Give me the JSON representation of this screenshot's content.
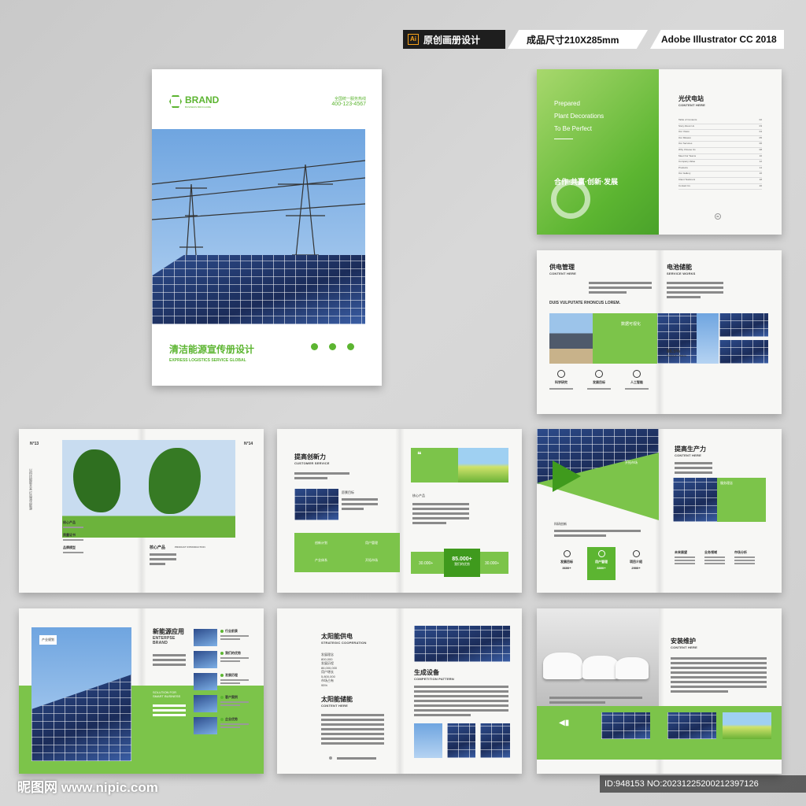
{
  "header": {
    "software_badge": "Ai",
    "tag1": "原创画册设计",
    "tag2": "成品尺寸210X285mm",
    "tag3": "Adobe Illustrator CC 2018"
  },
  "cover": {
    "brand": "BRAND",
    "brand_sub": "BUSINESS BROCHURE",
    "hotline_label": "全国统一服务热线",
    "hotline": "400-123-4567",
    "title_cn": "清洁能源宣传册设计",
    "title_en": "EXPRESS LOGISTICS SERVICE GLOBAL"
  },
  "spread_toc": {
    "prepared": "Prepared",
    "plant": "Plant Decorations",
    "perfect": "To Be Perfect",
    "slogan": "合作·共赢·创新·发展",
    "title": "光伏电站",
    "subtitle": "CONTENT HERE",
    "items": [
      "Table of Contents",
      "Story About Us",
      "Our Vision",
      "Our Mission",
      "Our Services",
      "Why Choose Us",
      "Meet Our Teams",
      "Company Value",
      "Products",
      "Our Gallery",
      "Client Testimoni",
      "Contact Us"
    ],
    "pages": [
      "02",
      "03",
      "04",
      "05",
      "06",
      "08",
      "10",
      "12",
      "14",
      "16",
      "18",
      "20"
    ],
    "page_badge": "01"
  },
  "spread_supply": {
    "title1": "供电管理",
    "sub1": "CONTENT HERE",
    "title2": "电池储能",
    "sub2": "SERVICE WORKS",
    "lead": "DUIS VULPUTATE RHONCUS LOREM.",
    "data_label": "数据可视化",
    "percent": "88.5%",
    "percent_label": "GRAPHIC / BIRTH",
    "icons": [
      "科学研究",
      "发展目标",
      "人工智能"
    ]
  },
  "spread_tree": {
    "n_left": "N°13",
    "n_right": "N°14",
    "vertical_text": "以科技赋能未来 打造清洁能源",
    "labels": [
      "核心产品",
      "质量证书",
      "品牌模型"
    ],
    "center_label": "核心产品",
    "center_sub": "PRODUCT INTRODUCTION"
  },
  "spread_innov": {
    "title": "提高创新力",
    "sub": "CUSTOMER SERVICE",
    "target": "愿景目标",
    "core": "核心产品",
    "g1": "创新计划",
    "g2": "用户管理",
    "g3": "产业体系",
    "g4": "开拓市场",
    "n1": "30.000+",
    "n2": "85.000+",
    "n2_label": "我们的优势",
    "n3": "30.000+"
  },
  "spread_prod": {
    "title": "提高生产力",
    "sub": "CONTENT HERE",
    "tag1": "开拓市场",
    "tag2": "服务理念",
    "lab1": "科研创新",
    "cols": [
      "未来展望",
      "业务领域",
      "市场分析"
    ],
    "stats": [
      {
        "label": "发展目标",
        "value": "3600+"
      },
      {
        "label": "用户管理",
        "value": "8800+"
      },
      {
        "label": "项目介绍",
        "value": "2900+"
      }
    ]
  },
  "spread_new": {
    "badge": "产业规划",
    "title": "新能源应用",
    "en1": "ENTERPSE",
    "en2": "BRAND",
    "solution": "SOLUTION FOR",
    "smart": "SMART BUSINESS",
    "list": [
      "行业前景",
      "我们的优势",
      "发展历程",
      "客户案例",
      "企业优势"
    ]
  },
  "spread_solar": {
    "title": "太阳能供电",
    "sub": "STRATEGIC COOPERATION",
    "stats_lines": [
      "发展理念",
      "800,000",
      "发展历程",
      "86,000,000",
      "用户增长",
      "5,800,000",
      "市场占有",
      "95%"
    ],
    "title2": "太阳能储能",
    "sub2": "CONTENT HERE",
    "equip": "生成设备",
    "equip_sub": "COMPETITION PATTERN"
  },
  "spread_install": {
    "title": "安装维护",
    "sub": "CONTENT HERE"
  },
  "footer": {
    "watermark": "昵图网 www.nipic.com",
    "id": "ID:948153 NO:20231225200212397126"
  }
}
